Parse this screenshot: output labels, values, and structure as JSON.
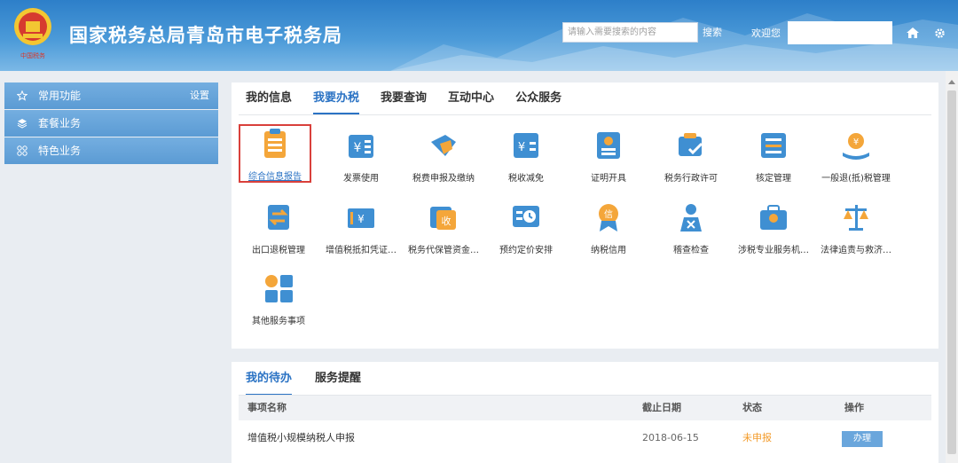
{
  "header": {
    "title": "国家税务总局青岛市电子税务局",
    "emblem_caption": "中国税务",
    "search_placeholder": "请输入需要搜索的内容",
    "search_label": "搜索",
    "welcome": "欢迎您",
    "home_icon": "home-icon",
    "settings_icon": "gear-icon"
  },
  "sidebar": {
    "items": [
      {
        "label": "常用功能",
        "icon": "star-icon",
        "extra": "设置"
      },
      {
        "label": "套餐业务",
        "icon": "layers-icon"
      },
      {
        "label": "特色业务",
        "icon": "grid-icon"
      }
    ]
  },
  "main": {
    "tabs": [
      "我的信息",
      "我要办税",
      "我要查询",
      "互动中心",
      "公众服务"
    ],
    "active_tab": "我要办税",
    "services": [
      "综合信息报告",
      "发票使用",
      "税费申报及缴纳",
      "税收减免",
      "证明开具",
      "税务行政许可",
      "核定管理",
      "一般退(抵)税管理",
      "出口退税管理",
      "增值税抵扣凭证…",
      "税务代保管资金…",
      "预约定价安排",
      "纳税信用",
      "稽查检查",
      "涉税专业服务机…",
      "法律追责与救济…",
      "其他服务事项"
    ]
  },
  "todo": {
    "tabs": [
      "我的待办",
      "服务提醒"
    ],
    "columns": [
      "事项名称",
      "截止日期",
      "状态",
      "操作"
    ],
    "rows": [
      {
        "name": "增值税小规模纳税人申报",
        "deadline": "2018-06-15",
        "status": "未申报",
        "action": "办理"
      }
    ]
  },
  "colors": {
    "accent": "#2b73c4",
    "highlight_border": "#d9403b",
    "status_pending": "#f39b2a",
    "header": "#3f8fd2"
  }
}
